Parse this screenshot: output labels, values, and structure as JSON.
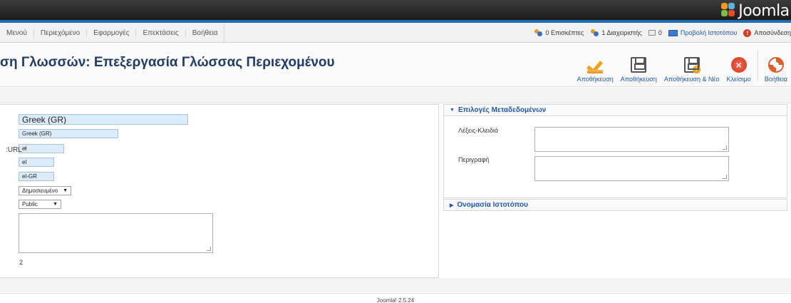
{
  "header": {
    "brand": "Joomla!",
    "colors": {
      "topbar": "#2b2b2b",
      "accent_strip": "#1c6fb5"
    }
  },
  "menu": {
    "items": [
      "Μενού",
      "Περιεχόμενο",
      "Εφαρμογές",
      "Επεκτάσεις",
      "Βοήθεια"
    ]
  },
  "status": {
    "visitors": "0 Επισκέπτες",
    "admins": "1 Διαχειριστής",
    "messages": "0",
    "view_site": "Προβολή Ιστοτόπου",
    "logout": "Αποσύνδεση"
  },
  "title": {
    "text": "ση Γλωσσών: Επεξεργασία Γλώσσας Περιεχομένου"
  },
  "toolbar": {
    "save": "Αποθήκευση",
    "save_close": "Αποθήκευση",
    "save_new": "Αποθήκευση & Νέο",
    "close": "Κλείσιμο",
    "help": "Βοήθεια"
  },
  "form": {
    "title_value": "Greek (GR)",
    "native_title_value": "Greek (GR)",
    "url_label": ":URL",
    "required_star": "*",
    "url_code_value": "el",
    "image_prefix_value": "el",
    "language_tag_value": "el-GR",
    "status_value": "Δημοσιευμένο",
    "access_value": "Public",
    "description_value": "",
    "id_value": "2"
  },
  "metadata": {
    "heading": "Επιλογές Μεταδεδομένων",
    "keywords_label": "Λέξεις-Κλειδιά",
    "description_label": "Περιγραφή"
  },
  "site_name": {
    "heading": "Ονομασία Ιστοτόπου"
  },
  "footer": {
    "text": "Joomla! 2.5.24"
  }
}
